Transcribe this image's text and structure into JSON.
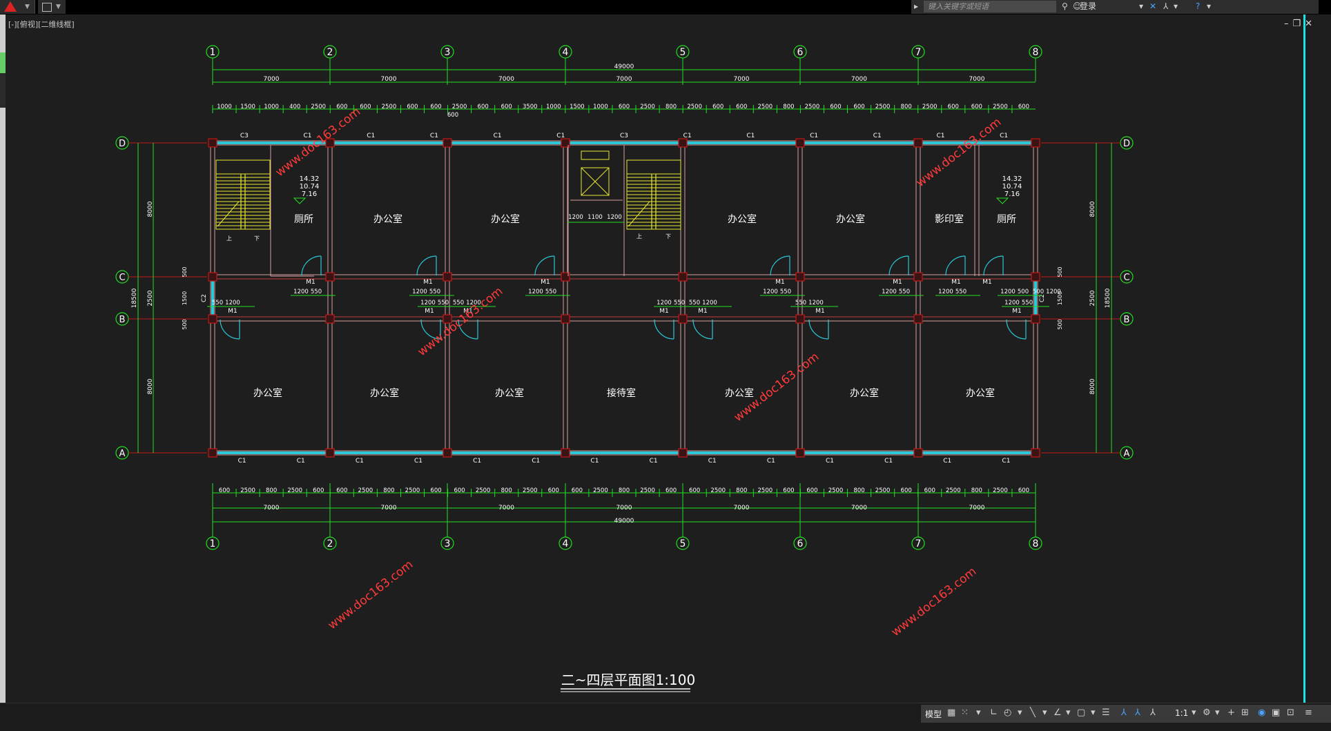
{
  "toolbar": {
    "search_placeholder": "键入关键字或短语",
    "login_label": "登录"
  },
  "viewport": {
    "label": "[-][俯视][二维线框]"
  },
  "grid": {
    "cols": [
      "1",
      "2",
      "3",
      "4",
      "5",
      "6",
      "7",
      "8"
    ],
    "rows": [
      "D",
      "C",
      "B",
      "A"
    ]
  },
  "dims": {
    "overall": "49000",
    "bay": "7000",
    "top_segments": [
      "1000",
      "1500",
      "1000",
      "400",
      "2500",
      "600",
      "600",
      "2500",
      "600",
      "600",
      "2500",
      "600",
      "600",
      "3500",
      "1000",
      "1500",
      "1000",
      "600",
      "2500",
      "800",
      "2500",
      "600",
      "600",
      "2500",
      "800",
      "2500",
      "600",
      "600",
      "2500",
      "800",
      "2500",
      "600",
      "600",
      "2500",
      "600"
    ],
    "top_extra": "600",
    "bottom_segments": [
      "600",
      "2500",
      "800",
      "2500",
      "600",
      "600",
      "2500",
      "800",
      "2500",
      "600",
      "600",
      "2500",
      "800",
      "2500",
      "600",
      "600",
      "2500",
      "800",
      "2500",
      "600",
      "600",
      "2500",
      "800",
      "2500",
      "600",
      "600",
      "2500",
      "800",
      "2500",
      "600",
      "600",
      "2500",
      "800",
      "2500",
      "600"
    ],
    "left_total": "18500",
    "left_parts": [
      "8000",
      "2500",
      "8000"
    ],
    "left_inner": [
      "500",
      "1500",
      "500"
    ],
    "right_total": "18500",
    "right_parts": [
      "8000",
      "2500",
      "8000"
    ],
    "right_inner": [
      "500",
      "1500",
      "500"
    ],
    "lift_dims": [
      "1200",
      "1100",
      "1200"
    ],
    "door_dims_c": [
      [
        "1200",
        "550"
      ],
      [
        "1200",
        "550"
      ],
      [
        "1200",
        "550"
      ],
      [
        "1200",
        "550"
      ],
      [
        "1200",
        "550"
      ],
      [
        "1200",
        "550"
      ],
      [
        "1200",
        "500",
        "500",
        "1200"
      ]
    ],
    "door_dims_b": [
      [
        "550",
        "1200"
      ],
      [
        "1200",
        "550",
        "550",
        "1200"
      ],
      [
        "1200",
        "550",
        "550",
        "1200"
      ],
      [
        "550",
        "1200"
      ],
      [
        "1200",
        "550"
      ]
    ]
  },
  "windows": {
    "north": [
      "C3",
      "C1",
      "C1",
      "C1",
      "C1",
      "C1",
      "C3",
      "C1",
      "C1",
      "C1",
      "C1",
      "C1",
      "C1"
    ],
    "south": [
      "C1",
      "C1",
      "C1",
      "C1",
      "C1",
      "C1",
      "C1",
      "C1",
      "C1",
      "C1",
      "C1",
      "C1",
      "C1",
      "C1"
    ],
    "c2": "C2"
  },
  "doors": {
    "label": "M1"
  },
  "rooms": {
    "north": [
      "厕所",
      "办公室",
      "办公室",
      "办公室",
      "办公室",
      "影印室",
      "厕所"
    ],
    "south": [
      "办公室",
      "办公室",
      "办公室",
      "接待室",
      "办公室",
      "办公室",
      "办公室"
    ]
  },
  "levels": [
    "14.32",
    "10.74",
    "7.16"
  ],
  "stairs": {
    "up": "上",
    "down": "下"
  },
  "watermark": "www.doc163.com",
  "title": "二~四层平面图1:100",
  "status": {
    "model": "模型",
    "scale": "1:1"
  }
}
